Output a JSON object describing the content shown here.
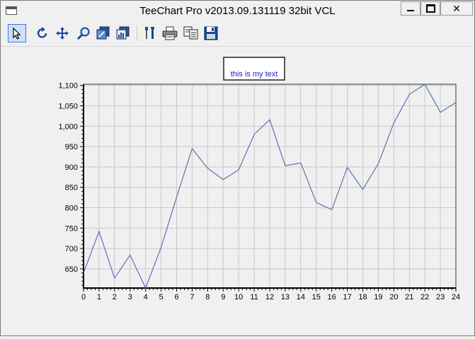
{
  "window": {
    "title": "TeeChart Pro v2013.09.131119 32bit VCL"
  },
  "toolbar": {
    "tools": [
      {
        "name": "select-pointer-icon",
        "active": true
      },
      {
        "name": "rotate-icon",
        "active": false
      },
      {
        "name": "move-icon",
        "active": false
      },
      {
        "name": "zoom-icon",
        "active": false
      },
      {
        "name": "depth-3d-icon",
        "active": false
      },
      {
        "name": "view-3d-icon",
        "active": false
      },
      {
        "name": "edit-chart-icon",
        "active": false
      },
      {
        "name": "print-icon",
        "active": false
      },
      {
        "name": "copy-icon",
        "active": false
      },
      {
        "name": "save-icon",
        "active": false
      }
    ]
  },
  "colors": {
    "series": "#5a74b0",
    "annotation_text": "#1a1ac8",
    "grid": "#c8c8c8",
    "plot_bg": "#f0f0f0"
  },
  "chart_data": {
    "type": "line",
    "annotation": "this is my text",
    "x": [
      0,
      1,
      2,
      3,
      4,
      5,
      6,
      7,
      8,
      9,
      10,
      11,
      12,
      13,
      14,
      15,
      16,
      17,
      18,
      19,
      20,
      21,
      22,
      23,
      24
    ],
    "series": [
      {
        "values": [
          640,
          742,
          627,
          684,
          603,
          703,
          826,
          945,
          897,
          869,
          893,
          980,
          1016,
          903,
          910,
          813,
          795,
          899,
          845,
          908,
          1008,
          1078,
          1103,
          1034,
          1058
        ]
      }
    ],
    "xlim": [
      0,
      24
    ],
    "ylim": [
      603,
      1103
    ],
    "yticks": [
      650,
      700,
      750,
      800,
      850,
      900,
      950,
      1000,
      1050,
      1100
    ],
    "ytick_labels": [
      "650",
      "700",
      "750",
      "800",
      "850",
      "900",
      "950",
      "1,000",
      "1,050",
      "1,100"
    ],
    "xtick_labels": [
      "0",
      "1",
      "2",
      "3",
      "4",
      "5",
      "6",
      "7",
      "8",
      "9",
      "10",
      "11",
      "12",
      "13",
      "14",
      "15",
      "16",
      "17",
      "18",
      "19",
      "20",
      "21",
      "22",
      "23",
      "24"
    ],
    "grid": true,
    "legend": "none"
  }
}
